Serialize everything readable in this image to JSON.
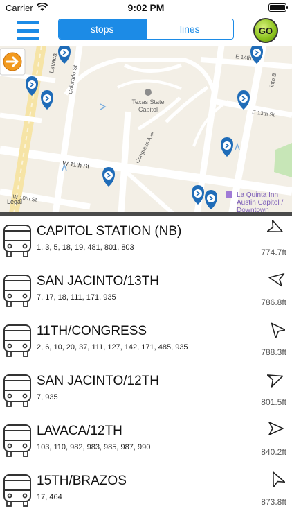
{
  "status_bar": {
    "carrier": "Carrier",
    "time": "9:02 PM",
    "battery_level": 1.0
  },
  "nav": {
    "tabs": [
      {
        "label": "stops",
        "active": true
      },
      {
        "label": "lines",
        "active": false
      }
    ],
    "go_label": "GO",
    "accent_color": "#1c8be6"
  },
  "map": {
    "streets": {
      "lavaca": "Lavaca",
      "colorado": "Colorado St",
      "w11th": "W 11th St",
      "w10th": "W 10th St",
      "congress": "Congress Ave",
      "e14th": "E 14th St",
      "e13th": "E 13th St",
      "jacinto": "into B"
    },
    "poi": {
      "capitol_line1": "Texas State",
      "capitol_line2": "Capitol",
      "hotel_line1": "La Quinta Inn",
      "hotel_line2": "Austin Capitol /",
      "hotel_line3": "Downtown"
    },
    "legal": "Legal",
    "pin_color": "#1f6cb8"
  },
  "stops": [
    {
      "name": "CAPITOL STATION (NB)",
      "routes": "1, 3, 5, 18, 19, 481, 801, 803",
      "distance": "774.7ft",
      "direction_icon": "navigation-arrow-icon"
    },
    {
      "name": "SAN JACINTO/13TH",
      "routes": "7, 17, 18, 111, 171, 935",
      "distance": "786.8ft",
      "direction_icon": "navigation-arrow-icon"
    },
    {
      "name": "11TH/CONGRESS",
      "routes": "2, 6, 10, 20, 37, 111, 127, 142, 171, 485, 935",
      "distance": "788.3ft",
      "direction_icon": "navigation-arrow-icon"
    },
    {
      "name": "SAN JACINTO/12TH",
      "routes": "7, 935",
      "distance": "801.5ft",
      "direction_icon": "navigation-arrow-icon"
    },
    {
      "name": "LAVACA/12TH",
      "routes": "103, 110, 982, 983, 985, 987, 990",
      "distance": "840.2ft",
      "direction_icon": "navigation-arrow-icon"
    },
    {
      "name": "15TH/BRAZOS",
      "routes": "17, 464",
      "distance": "873.8ft",
      "direction_icon": "navigation-arrow-icon"
    }
  ]
}
